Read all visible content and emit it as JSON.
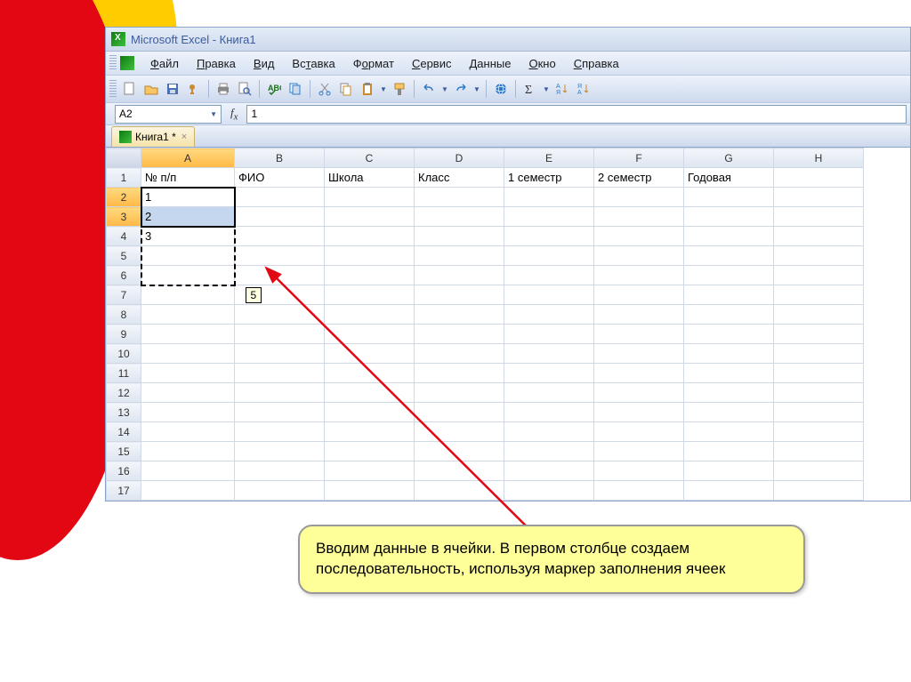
{
  "window_title": "Microsoft Excel - Книга1",
  "menus": [
    "Файл",
    "Правка",
    "Вид",
    "Вставка",
    "Формат",
    "Сервис",
    "Данные",
    "Окно",
    "Справка"
  ],
  "menu_underline_idx": [
    0,
    0,
    0,
    2,
    1,
    0,
    0,
    0,
    0
  ],
  "namebox": "A2",
  "formula": "1",
  "doc_tab": "Книга1 *",
  "columns": [
    "A",
    "B",
    "C",
    "D",
    "E",
    "F",
    "G",
    "H"
  ],
  "row_count": 17,
  "selected_col": "A",
  "selected_rows": [
    2,
    3
  ],
  "headers_row1": [
    "№ п/п",
    "ФИО",
    "Школа",
    "Класс",
    "1 семестр",
    "2 семестр",
    "Годовая",
    ""
  ],
  "cells_colA": {
    "2": "1",
    "3": "2",
    "4": "3"
  },
  "tooltip_value": "5",
  "callout_text": "Вводим данные в ячейки. В первом столбце создаем последовательность, используя маркер заполнения ячеек",
  "icons": {
    "new": "#fff",
    "open": "#f7c566",
    "save": "#4a6fb5",
    "perm": "#c98b2e",
    "print": "#888",
    "preview": "#4a6fb5",
    "spell": "#1a6e1a",
    "research": "#2e7bc9",
    "cut": "#888",
    "copy": "#c98b2e",
    "paste": "#c98b2e",
    "fmt": "#f7c566",
    "undo": "#2e7bc9",
    "redo": "#2e7bc9",
    "link": "#2e7bc9",
    "sum": "#333",
    "sortaz": "#2e7bc9",
    "sortza": "#2e7bc9"
  }
}
